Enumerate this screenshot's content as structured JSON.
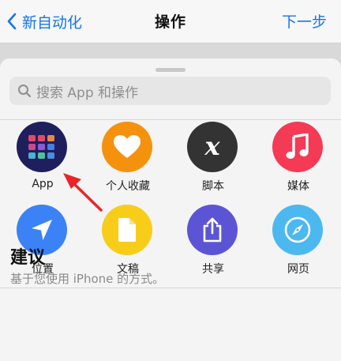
{
  "nav": {
    "back_label": "新自动化",
    "title": "操作",
    "next_label": "下一步"
  },
  "search": {
    "placeholder": "搜索 App 和操作"
  },
  "categories": [
    {
      "label": "App",
      "icon": "app-grid-icon",
      "color": "#1f1f5e"
    },
    {
      "label": "个人收藏",
      "icon": "heart-icon",
      "color": "#f5920d"
    },
    {
      "label": "脚本",
      "icon": "script-x-icon",
      "color": "#333333"
    },
    {
      "label": "媒体",
      "icon": "music-note-icon",
      "color": "#f53a55"
    },
    {
      "label": "位置",
      "icon": "location-arrow-icon",
      "color": "#3a82f6"
    },
    {
      "label": "文稿",
      "icon": "document-icon",
      "color": "#f7cd1a"
    },
    {
      "label": "共享",
      "icon": "share-icon",
      "color": "#5b55d6"
    },
    {
      "label": "网页",
      "icon": "compass-icon",
      "color": "#4cb8f0"
    }
  ],
  "suggestions": {
    "title": "建议",
    "subtitle": "基于您使用 iPhone 的方式。"
  },
  "colors": {
    "accent": "#1a73e8",
    "annotation_arrow": "#e8262a"
  }
}
